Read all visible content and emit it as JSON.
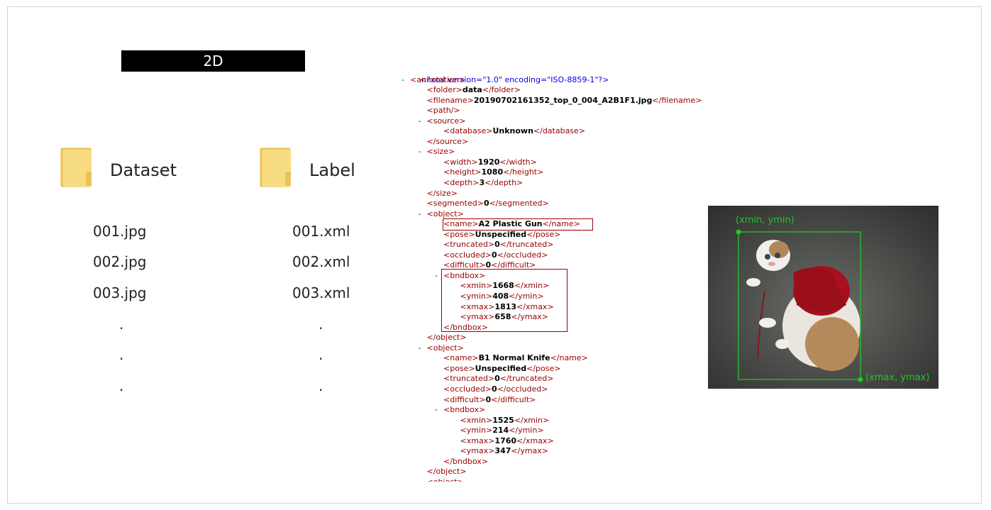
{
  "title": "2D",
  "folders": [
    {
      "label": "Dataset",
      "files": [
        "001.jpg",
        "002.jpg",
        "003.jpg"
      ],
      "dots": [
        ".",
        ".",
        "."
      ]
    },
    {
      "label": "Label",
      "files": [
        "001.xml",
        "002.xml",
        "003.xml"
      ],
      "dots": [
        ".",
        ".",
        "."
      ]
    }
  ],
  "xml": {
    "declaration": "<?xml version=\"1.0\" encoding=\"ISO-8859-1\"?>",
    "lines": [
      {
        "minus": true,
        "indent": 1,
        "open": "<annotation>",
        "value": "",
        "close": ""
      },
      {
        "minus": false,
        "indent": 2,
        "open": "<folder>",
        "value": "data",
        "close": "</folder>"
      },
      {
        "minus": false,
        "indent": 2,
        "open": "<filename>",
        "value": "20190702161352_top_0_004_A2B1F1.jpg",
        "close": "</filename>"
      },
      {
        "minus": false,
        "indent": 2,
        "open": "<path/>",
        "value": "",
        "close": ""
      },
      {
        "minus": true,
        "indent": 2,
        "open": "<source>",
        "value": "",
        "close": ""
      },
      {
        "minus": false,
        "indent": 3,
        "open": "<database>",
        "value": "Unknown",
        "close": "</database>"
      },
      {
        "minus": false,
        "indent": 2,
        "open": "</source>",
        "value": "",
        "close": ""
      },
      {
        "minus": true,
        "indent": 2,
        "open": "<size>",
        "value": "",
        "close": ""
      },
      {
        "minus": false,
        "indent": 3,
        "open": "<width>",
        "value": "1920",
        "close": "</width>"
      },
      {
        "minus": false,
        "indent": 3,
        "open": "<height>",
        "value": "1080",
        "close": "</height>"
      },
      {
        "minus": false,
        "indent": 3,
        "open": "<depth>",
        "value": "3",
        "close": "</depth>"
      },
      {
        "minus": false,
        "indent": 2,
        "open": "</size>",
        "value": "",
        "close": ""
      },
      {
        "minus": false,
        "indent": 2,
        "open": "<segmented>",
        "value": "0",
        "close": "</segmented>"
      },
      {
        "minus": true,
        "indent": 2,
        "open": "<object>",
        "value": "",
        "close": ""
      },
      {
        "minus": false,
        "indent": 3,
        "open": "<name>",
        "value": "A2 Plastic Gun",
        "close": "</name>"
      },
      {
        "minus": false,
        "indent": 3,
        "open": "<pose>",
        "value": "Unspecified",
        "close": "</pose>"
      },
      {
        "minus": false,
        "indent": 3,
        "open": "<truncated>",
        "value": "0",
        "close": "</truncated>"
      },
      {
        "minus": false,
        "indent": 3,
        "open": "<occluded>",
        "value": "0",
        "close": "</occluded>"
      },
      {
        "minus": false,
        "indent": 3,
        "open": "<difficult>",
        "value": "0",
        "close": "</difficult>"
      },
      {
        "minus": true,
        "indent": 3,
        "open": "<bndbox>",
        "value": "",
        "close": ""
      },
      {
        "minus": false,
        "indent": 4,
        "open": "<xmin>",
        "value": "1668",
        "close": "</xmin>"
      },
      {
        "minus": false,
        "indent": 4,
        "open": "<ymin>",
        "value": "408",
        "close": "</ymin>"
      },
      {
        "minus": false,
        "indent": 4,
        "open": "<xmax>",
        "value": "1813",
        "close": "</xmax>"
      },
      {
        "minus": false,
        "indent": 4,
        "open": "<ymax>",
        "value": "658",
        "close": "</ymax>"
      },
      {
        "minus": false,
        "indent": 3,
        "open": "</bndbox>",
        "value": "",
        "close": ""
      },
      {
        "minus": false,
        "indent": 2,
        "open": "</object>",
        "value": "",
        "close": ""
      },
      {
        "minus": true,
        "indent": 2,
        "open": "<object>",
        "value": "",
        "close": ""
      },
      {
        "minus": false,
        "indent": 3,
        "open": "<name>",
        "value": "B1 Normal Knife",
        "close": "</name>"
      },
      {
        "minus": false,
        "indent": 3,
        "open": "<pose>",
        "value": "Unspecified",
        "close": "</pose>"
      },
      {
        "minus": false,
        "indent": 3,
        "open": "<truncated>",
        "value": "0",
        "close": "</truncated>"
      },
      {
        "minus": false,
        "indent": 3,
        "open": "<occluded>",
        "value": "0",
        "close": "</occluded>"
      },
      {
        "minus": false,
        "indent": 3,
        "open": "<difficult>",
        "value": "0",
        "close": "</difficult>"
      },
      {
        "minus": true,
        "indent": 3,
        "open": "<bndbox>",
        "value": "",
        "close": ""
      },
      {
        "minus": false,
        "indent": 4,
        "open": "<xmin>",
        "value": "1525",
        "close": "</xmin>"
      },
      {
        "minus": false,
        "indent": 4,
        "open": "<ymin>",
        "value": "214",
        "close": "</ymin>"
      },
      {
        "minus": false,
        "indent": 4,
        "open": "<xmax>",
        "value": "1760",
        "close": "</xmax>"
      },
      {
        "minus": false,
        "indent": 4,
        "open": "<ymax>",
        "value": "347",
        "close": "</ymax>"
      },
      {
        "minus": false,
        "indent": 3,
        "open": "</bndbox>",
        "value": "",
        "close": ""
      },
      {
        "minus": false,
        "indent": 2,
        "open": "</object>",
        "value": "",
        "close": ""
      },
      {
        "minus": false,
        "indent": 2,
        "open": "<object>",
        "value": "",
        "close": ""
      }
    ]
  },
  "image_example": {
    "top_left_label": "(xmin, ymin)",
    "bottom_right_label": "(xmax, ymax)"
  },
  "colors": {
    "xml_tag": "#990000",
    "xml_pi": "#0000ee",
    "highlight_box": "#990000",
    "bbox_green": "#22c522",
    "folder_yellow": "#f5d36b"
  }
}
